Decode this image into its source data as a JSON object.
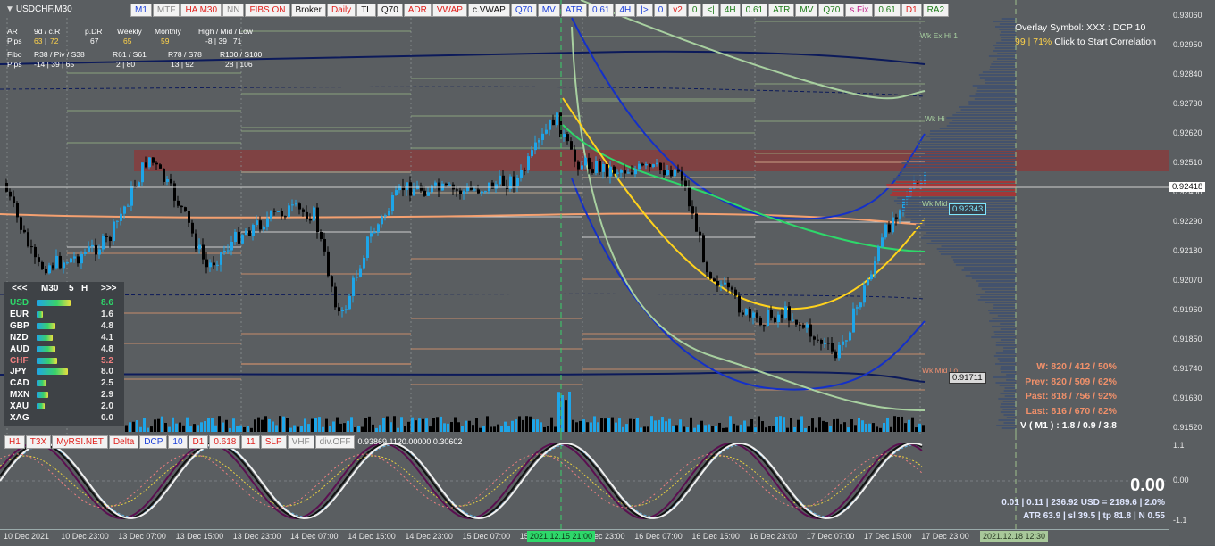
{
  "window": {
    "symbol": "USDCHF,M30"
  },
  "toolbar": [
    {
      "label": "M1",
      "color": "blue"
    },
    {
      "label": "MTF",
      "color": "gray"
    },
    {
      "label": "HA M30",
      "color": "red"
    },
    {
      "label": "NN",
      "color": "gray"
    },
    {
      "label": "FIBS ON",
      "color": "red"
    },
    {
      "label": "Broker",
      "color": "black"
    },
    {
      "label": "Daily",
      "color": "red"
    },
    {
      "label": "TL",
      "color": "black"
    },
    {
      "label": "Q70",
      "color": "black"
    },
    {
      "label": "ADR",
      "color": "red"
    },
    {
      "label": "VWAP",
      "color": "red"
    },
    {
      "label": "c.VWAP",
      "color": "black"
    },
    {
      "label": "Q70",
      "color": "blue"
    },
    {
      "label": "MV",
      "color": "blue"
    },
    {
      "label": "ATR",
      "color": "blue"
    },
    {
      "label": "0.61",
      "color": "blue"
    },
    {
      "label": "4H",
      "color": "blue"
    },
    {
      "label": "|>",
      "color": "blue"
    },
    {
      "label": "0",
      "color": "blue"
    },
    {
      "label": "v2",
      "color": "red"
    },
    {
      "label": "0",
      "color": "green"
    },
    {
      "label": "<|",
      "color": "green"
    },
    {
      "label": "4H",
      "color": "green"
    },
    {
      "label": "0.61",
      "color": "green"
    },
    {
      "label": "ATR",
      "color": "green"
    },
    {
      "label": "MV",
      "color": "green"
    },
    {
      "label": "Q70",
      "color": "green"
    },
    {
      "label": "s.Fix",
      "color": "mag"
    },
    {
      "label": "0.61",
      "color": "green"
    },
    {
      "label": "D1",
      "color": "red"
    },
    {
      "label": "RA2",
      "color": "green"
    }
  ],
  "info_table": {
    "header": [
      "AR",
      "9d / c.R",
      "p.DR",
      "Weekly",
      "Monthly",
      "High / Mid / Low"
    ],
    "pips_label": "Pips",
    "ar_pips": [
      "63",
      "72",
      "67",
      "65",
      "59",
      "-8 | 39 | 71"
    ],
    "fibo_header": [
      "Fibo",
      "R38 / Piv / S38",
      "R61 / S61",
      "R78 / S78",
      "R100 / S100"
    ],
    "fibo_pips": [
      "-14 | 39 | 65",
      "2 | 80",
      "13 | 92",
      "28 | 106"
    ]
  },
  "currency_strength": {
    "nav_prev": "<<<",
    "timeframe": "M30",
    "period": "5",
    "suffix": "H",
    "nav_next": ">>>",
    "rows": [
      {
        "name": "USD",
        "value": "8.6",
        "pct": 0.86,
        "highlight": "green"
      },
      {
        "name": "EUR",
        "value": "1.6",
        "pct": 0.16,
        "highlight": "none"
      },
      {
        "name": "GBP",
        "value": "4.8",
        "pct": 0.48,
        "highlight": "none"
      },
      {
        "name": "NZD",
        "value": "4.1",
        "pct": 0.41,
        "highlight": "none"
      },
      {
        "name": "AUD",
        "value": "4.8",
        "pct": 0.48,
        "highlight": "none"
      },
      {
        "name": "CHF",
        "value": "5.2",
        "pct": 0.52,
        "highlight": "red"
      },
      {
        "name": "JPY",
        "value": "8.0",
        "pct": 0.8,
        "highlight": "none"
      },
      {
        "name": "CAD",
        "value": "2.5",
        "pct": 0.25,
        "highlight": "none"
      },
      {
        "name": "MXN",
        "value": "2.9",
        "pct": 0.29,
        "highlight": "none"
      },
      {
        "name": "XAU",
        "value": "2.0",
        "pct": 0.2,
        "highlight": "none"
      },
      {
        "name": "XAG",
        "value": "0.0",
        "pct": 0.0,
        "highlight": "none"
      }
    ]
  },
  "overlay": {
    "line1": "Overlay Symbol: XXX : DCP 10",
    "line2_a": "99",
    "line2_b": "71%",
    "line2_c": "Click to Start Correlation"
  },
  "stats": {
    "w": "W: 820 / 412 / 50%",
    "prev": "Prev: 820 / 509 / 62%",
    "past": "Past: 818 / 756 / 92%",
    "last": "Last: 816 / 670 / 82%",
    "v": "V ( M1 ) : 1.8 / 0.9 / 3.8"
  },
  "price_axis": [
    "0.93060",
    "0.92950",
    "0.92840",
    "0.92730",
    "0.92620",
    "0.92510",
    "0.92400",
    "0.92290",
    "0.92180",
    "0.92070",
    "0.91960",
    "0.91850",
    "0.91740",
    "0.91630",
    "0.91520"
  ],
  "price_tags": {
    "current": "0.92418",
    "mid": "0.92343",
    "low": "0.91711"
  },
  "levels_labels": {
    "wk_ex_hi": "Wk Ex Hi 1",
    "wk_hi": "Wk Hi",
    "wk_mid": "Wk Mid",
    "wk_mid_lo": "Wk Mid Lo"
  },
  "indicator_toolbar": [
    {
      "label": "H1",
      "color": "red"
    },
    {
      "label": "T3X",
      "color": "red"
    },
    {
      "label": "MyRSI.NET",
      "color": "red"
    },
    {
      "label": "Delta",
      "color": "red"
    },
    {
      "label": "DCP",
      "color": "blue"
    },
    {
      "label": "10",
      "color": "blue"
    },
    {
      "label": "D1",
      "color": "red"
    },
    {
      "label": "0.618",
      "color": "red"
    },
    {
      "label": "11",
      "color": "red"
    },
    {
      "label": "SLP",
      "color": "red"
    },
    {
      "label": "VHF",
      "color": "gray"
    },
    {
      "label": "div.OFF",
      "color": "gray"
    }
  ],
  "indicator_values": "0.93869 1120.00000 0.30602",
  "indicator_axis": [
    "1.1",
    "0.00",
    "-1.1"
  ],
  "bottom_panel": {
    "big_value": "0.00",
    "line1": "0.01  |  0.11  |  236.92 USD = 2189.6  |  2.0%",
    "line2": "ATR 63.9  |  sl 39.5  |  tp 81.8  |  N 0.55"
  },
  "time_axis": [
    "10 Dec 2021",
    "10 Dec 23:00",
    "13 Dec 07:00",
    "13 Dec 15:00",
    "13 Dec 23:00",
    "14 Dec 07:00",
    "14 Dec 15:00",
    "14 Dec 23:00",
    "15 Dec 07:00",
    "15 Dec 15:00",
    "15 Dec 23:00",
    "16 Dec 07:00",
    "16 Dec 15:00",
    "16 Dec 23:00",
    "17 Dec 07:00",
    "17 Dec 15:00",
    "17 Dec 23:00"
  ],
  "time_highlights": {
    "cursor": "2021.12.15 21:00",
    "right": "2021.12.18 12:30"
  },
  "colors": {
    "bull": "#1ea5e8",
    "bear": "#000000",
    "ma_green": "#2ed86a",
    "ma_yellow": "#ffd21c",
    "ma_blue": "#1430c8",
    "vwap": "#f4a070",
    "zone": "#8c3a3a"
  }
}
